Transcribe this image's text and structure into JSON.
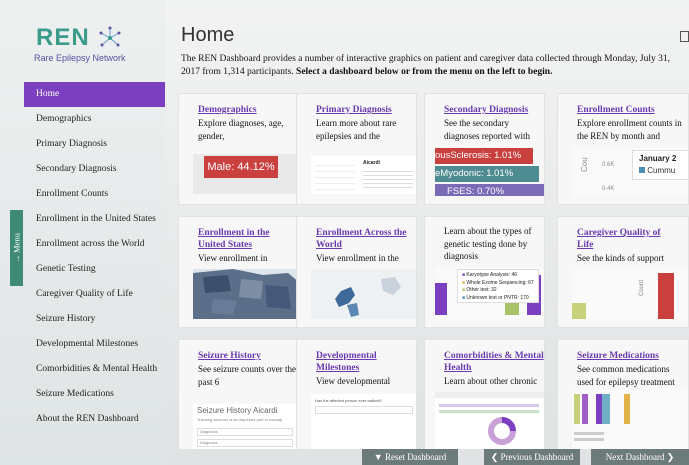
{
  "brand": {
    "logo_text": "REN",
    "logo_subtitle": "Rare Epilepsy Network",
    "accent_purple": "#7b3fbf",
    "accent_teal": "#3c9c8c"
  },
  "sidebar": {
    "menu_tab": "Menu",
    "items": [
      {
        "label": "Home",
        "active": true
      },
      {
        "label": "Demographics"
      },
      {
        "label": "Primary Diagnosis"
      },
      {
        "label": "Secondary Diagnosis"
      },
      {
        "label": "Enrollment Counts"
      },
      {
        "label": "Enrollment in the United States"
      },
      {
        "label": "Enrollment across the World"
      },
      {
        "label": "Genetic Testing"
      },
      {
        "label": "Caregiver Quality of Life"
      },
      {
        "label": "Seizure History"
      },
      {
        "label": "Developmental Milestones"
      },
      {
        "label": "Comorbidities & Mental Health"
      },
      {
        "label": "Seizure Medications"
      },
      {
        "label": "About the REN Dashboard"
      }
    ]
  },
  "main": {
    "title": "Home",
    "intro": "The REN Dashboard provides a number of interactive graphics on patient and caregiver data collected through Monday, July 31, 2017 from 1,314 participants.",
    "intro_bold": "Select a dashboard below or from the menu on the left to begin.",
    "cards": [
      {
        "title": "Demographics",
        "desc": "Explore diagnoses, age, gender,",
        "thumb_text": "Male: 44.12%"
      },
      {
        "title": "Primary Diagnosis",
        "desc": "Learn more about rare epilepsies and the",
        "thumb_text": "Aicardi"
      },
      {
        "title": "Secondary Diagnosis",
        "desc": "See the secondary diagnoses reported with",
        "thumb_lines": [
          "ousSclerosis: 1.01%",
          "eMyodonic: 1.01%",
          "FSES: 0.70%"
        ]
      },
      {
        "title": "Enrollment Counts",
        "desc": "Explore enrollment counts in the REN by month and",
        "thumb_month": "January 2",
        "thumb_legend": "Cummu",
        "thumb_axis": "Cou",
        "thumb_ticks": [
          "0.6K",
          "0.4K"
        ]
      },
      {
        "title": "Enrollment in the United States",
        "desc": "View enrollment in"
      },
      {
        "title": "Enrollment Across the World",
        "desc": "View enrollment in the"
      },
      {
        "title": "",
        "desc": "Learn about the types of genetic testing done by diagnosis",
        "thumb_legend": [
          "Karyotype Analysis: 46",
          "Whole Exome Sequencing: 67",
          "Other test: 32",
          "Unknown test or PNTR: 170"
        ]
      },
      {
        "title": "Caregiver Quality of Life",
        "desc": "See the kinds of support",
        "thumb_axis": "Count"
      },
      {
        "title": "Seizure History",
        "desc": "See seizure counts over the past 6",
        "thumb_title": "Seizure History  Aicardi",
        "thumb_sub": "Tracking seizures is an important part of managi",
        "thumb_fields": [
          "Diagnosis",
          "Diagnosis"
        ]
      },
      {
        "title": "Developmental Milestones",
        "desc": "View developmental",
        "thumb_question": "Has the affected person ever walked?"
      },
      {
        "title": "Comorbidities & Mental Health",
        "desc": "Learn about other chronic"
      },
      {
        "title": "Seizure Medications",
        "desc": "See common medications used for epilepsy treatment"
      }
    ]
  },
  "footer": {
    "reset": "Reset Dashboard",
    "previous": "Previous Dashboard",
    "next": "Next Dashboard"
  }
}
